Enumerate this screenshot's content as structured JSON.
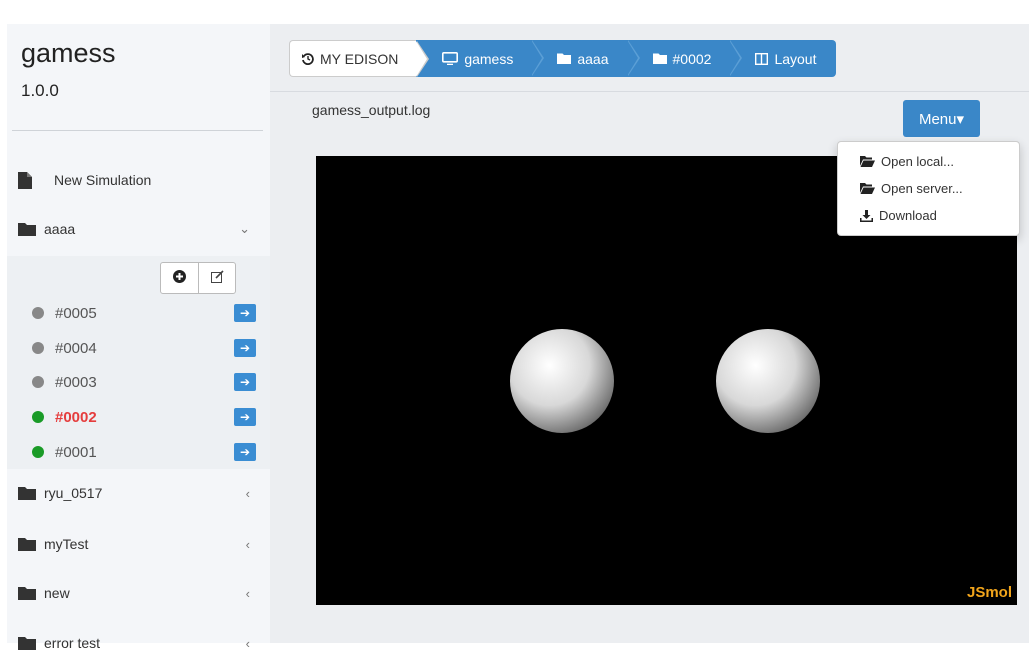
{
  "sidebar": {
    "app_title": "gamess",
    "app_version": "1.0.0",
    "new_simulation": "New Simulation",
    "folders": [
      {
        "label": "aaaa",
        "chevron": "⌄",
        "expanded": true
      },
      {
        "label": "ryu_0517",
        "chevron": "‹",
        "expanded": false
      },
      {
        "label": "myTest",
        "chevron": "‹",
        "expanded": false
      },
      {
        "label": "new",
        "chevron": "‹",
        "expanded": false
      },
      {
        "label": "error test",
        "chevron": "‹",
        "expanded": false
      }
    ],
    "tools": {
      "add_icon": "plus-circle-icon",
      "edit_icon": "edit-icon"
    },
    "jobs": [
      {
        "label": "#0005",
        "status": "gray",
        "active": false
      },
      {
        "label": "#0004",
        "status": "gray",
        "active": false
      },
      {
        "label": "#0003",
        "status": "gray",
        "active": false
      },
      {
        "label": "#0002",
        "status": "green",
        "active": true
      },
      {
        "label": "#0001",
        "status": "green",
        "active": false
      }
    ]
  },
  "breadcrumb": {
    "items": [
      {
        "label": "MY EDISON",
        "icon": "history-icon"
      },
      {
        "label": "gamess",
        "icon": "monitor-icon"
      },
      {
        "label": "aaaa",
        "icon": "folder-icon"
      },
      {
        "label": "#0002",
        "icon": "folder-icon"
      },
      {
        "label": "Layout",
        "icon": "columns-icon"
      }
    ]
  },
  "viewer": {
    "file_name": "gamess_output.log",
    "menu_label": "Menu▾",
    "logo": "JSmol",
    "menu_items": [
      {
        "label": "Open local...",
        "icon": "folder-open-icon"
      },
      {
        "label": "Open server...",
        "icon": "folder-open-icon"
      },
      {
        "label": "Download",
        "icon": "download-icon"
      }
    ]
  },
  "colors": {
    "accent": "#3a87c8",
    "active_job": "#e53d3d",
    "status_green": "#1a9b27",
    "status_gray": "#888888",
    "jsmol_logo": "#f2a51b"
  }
}
